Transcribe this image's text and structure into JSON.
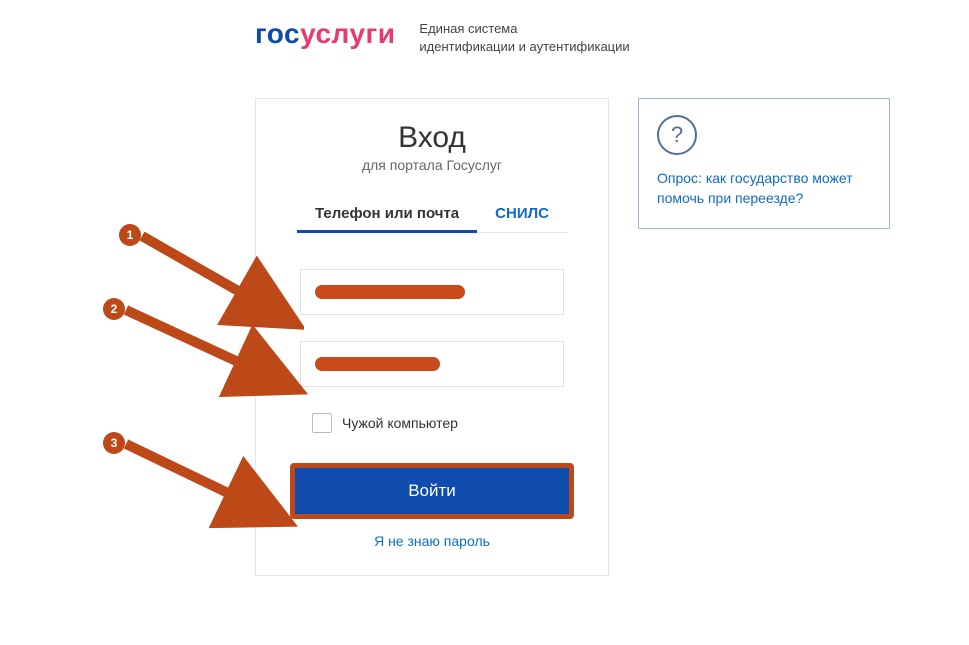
{
  "header": {
    "logo_part1": "гос",
    "logo_part2": "услуги",
    "tagline_line1": "Единая система",
    "tagline_line2": "идентификации и аутентификации"
  },
  "login": {
    "title": "Вход",
    "subtitle": "для портала Госуслуг",
    "tab_phone_email": "Телефон или почта",
    "tab_snils": "СНИЛС",
    "checkbox_label": "Чужой компьютер",
    "submit_label": "Войти",
    "forgot_label": "Я не знаю пароль"
  },
  "help": {
    "icon_glyph": "?",
    "text": "Опрос: как государство может помочь при переезде?"
  },
  "annotations": {
    "n1": "1",
    "n2": "2",
    "n3": "3"
  }
}
